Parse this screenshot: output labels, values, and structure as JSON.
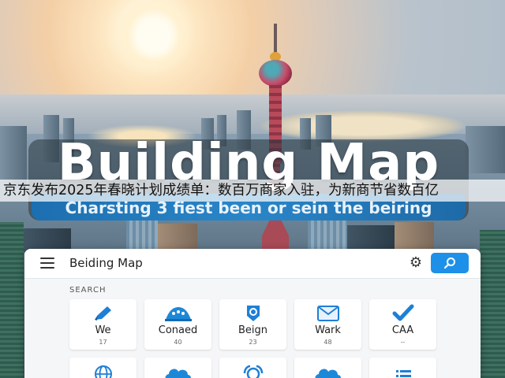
{
  "banner": {
    "title": "Building Map",
    "subtitle": "Charsting 3 fiest been or sein the beiring"
  },
  "headline": "京东发布2025年春晓计划成绩单：数百万商家入驻，为新商节省数百亿",
  "app": {
    "title": "Beiding Map",
    "section_label": "SEARCH",
    "icons": {
      "menu": "menu-icon",
      "settings": "gear-icon",
      "search": "search-icon"
    },
    "accent_color": "#1e90e8",
    "tiles": [
      {
        "label": "We",
        "sub": "17",
        "icon": "pen-icon"
      },
      {
        "label": "Conaed",
        "sub": "40",
        "icon": "crown-icon"
      },
      {
        "label": "Beign",
        "sub": "23",
        "icon": "badge-icon"
      },
      {
        "label": "Wark",
        "sub": "48",
        "icon": "mail-icon"
      },
      {
        "label": "CAA",
        "sub": "--",
        "icon": "check-icon"
      }
    ],
    "tiles_row2": [
      {
        "icon": "globe-icon"
      },
      {
        "icon": "cloud-icon"
      },
      {
        "icon": "person-icon"
      },
      {
        "icon": "cloud-icon"
      },
      {
        "icon": "list-icon"
      }
    ]
  }
}
